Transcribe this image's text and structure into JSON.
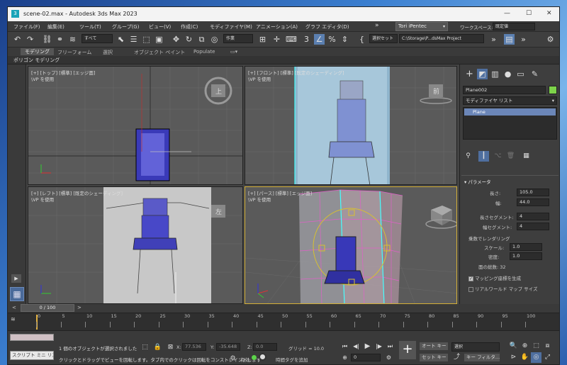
{
  "window": {
    "title": "scene-02.max - Autodesk 3ds Max 2023",
    "minimize_glyph": "—",
    "maximize_glyph": "☐",
    "close_glyph": "✕"
  },
  "menu": {
    "items": [
      "ファイル(F)",
      "編集(E)",
      "ツール(T)",
      "グループ(G)",
      "ビュー(V)",
      "作成(C)",
      "モディファイヤ(M)",
      "アニメーション(A)",
      "グラフ エディタ(D)"
    ],
    "more": "»",
    "user": "Tori iPentec",
    "workspace_label": "ワークスペース:",
    "workspace_value": "既定値"
  },
  "toolbar": {
    "selection_filter": "すべて",
    "ref_coord": "作業",
    "named_selection": "選択セット",
    "project_path": "C:\\Storage\\P...dsMax Project"
  },
  "ribbon": {
    "tabs": [
      "モデリング",
      "フリーフォーム",
      "選択",
      "オブジェクト ペイント",
      "Populate"
    ],
    "active_tab": "モデリング",
    "sub_label": "ポリゴン モデリング"
  },
  "viewports": {
    "top": {
      "label": "[+] [トップ] [標準] [エッジ面]",
      "sub": "\\VP を使用",
      "cube": "上"
    },
    "front": {
      "label": "[+] [フロント] [標準] [既定のシェーディング]",
      "sub": "\\VP を使用",
      "cube": "前"
    },
    "left": {
      "label": "[+] [レフト] [標準] [既定のシェーディング]",
      "sub": "\\VP を使用",
      "cube": "左"
    },
    "persp": {
      "label": "[+] [パース] [標準] [エッジ面]",
      "sub": "\\VP を使用"
    }
  },
  "command_panel": {
    "object_name": "Plane002",
    "object_color": "#7dd34a",
    "modifier_list": "モディファイヤ リスト",
    "stack_item": "Plane",
    "rollout_title": "パラメータ",
    "length_label": "長さ:",
    "length_value": "105.0",
    "width_label": "幅:",
    "width_value": "44.0",
    "length_segs_label": "長さセグメント:",
    "length_segs_value": "4",
    "width_segs_label": "幅セグメント:",
    "width_segs_value": "4",
    "render_mult_label": "乗数でレンダリング",
    "scale_label": "スケール:",
    "scale_value": "1.0",
    "density_label": "密度:",
    "density_value": "1.0",
    "total_faces": "面の総数: 32",
    "gen_mapping": "マッピング座標を生成",
    "real_world": "リアルワールド マップ サイズ"
  },
  "timeline": {
    "frame": "0 / 100",
    "ticks": [
      "0",
      "5",
      "10",
      "15",
      "20",
      "25",
      "30",
      "35",
      "40",
      "45",
      "50",
      "55",
      "60",
      "65",
      "70",
      "75",
      "80",
      "85",
      "90",
      "95",
      "100"
    ]
  },
  "status": {
    "script_label": "スクリプト ミニ リス",
    "selected": "1 個のオブジェクトが選択されました",
    "hint": "クリックとドラッグでビューを回転します。タブ内でのクリックは回転をコンストレイントします",
    "x_label": "X:",
    "x_value": "77.536",
    "y_label": "Y:",
    "y_value": "-35.648",
    "z_label": "Z:",
    "z_value": "0.0",
    "grid": "グリッド = 10.0",
    "enabled": "有効:",
    "add_time_tag": "時間タグを追加",
    "auto_key": "オート キー",
    "set_key": "セット キー",
    "selection": "選択",
    "key_filters": "キー フィルタ...",
    "frame_field": "0"
  }
}
